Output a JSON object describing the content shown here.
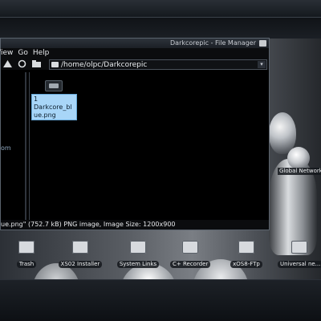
{
  "window": {
    "title": "Darkcorepic - File Manager",
    "menu": [
      "View",
      "Go",
      "Help"
    ],
    "path": "/home/olpc/Darkcorepic",
    "side_text": "om",
    "selected_file": "1\nDarkcore_bl\nue.png",
    "status": "ue.png\" (752.7 kB) PNG image, Image Size: 1200x900"
  },
  "desktop": {
    "global_label": "Global Network",
    "icons": [
      {
        "label": "Trash",
        "icon": "trash-icon"
      },
      {
        "label": "XS02 Installer",
        "icon": "installer-icon"
      },
      {
        "label": "System Links",
        "icon": "links-icon"
      },
      {
        "label": "C+ Recorder",
        "icon": "recorder-icon"
      },
      {
        "label": "xOS8-FTp",
        "icon": "ftp-icon"
      },
      {
        "label": "Universal ne...",
        "icon": "universal-icon"
      }
    ]
  },
  "colors": {
    "selection": "#a8d6f8",
    "path_text": "#e9ecef"
  }
}
